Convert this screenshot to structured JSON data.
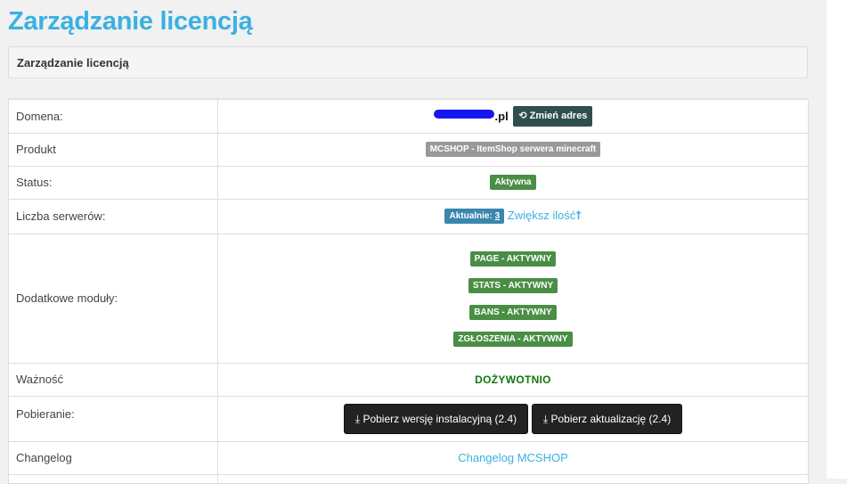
{
  "page": {
    "title": "Zarządzanie licencją",
    "panel_heading": "Zarządzanie licencją"
  },
  "rows": {
    "domain": {
      "label": "Domena:",
      "value_suffix": ".pl",
      "change_button": "Zmień adres"
    },
    "product": {
      "label": "Produkt",
      "value": "MCSHOP - ItemShop serwera minecraft"
    },
    "status": {
      "label": "Status:",
      "value": "Aktywna"
    },
    "servers": {
      "label": "Liczba serwerów:",
      "current_label": "Aktualnie:",
      "current_value": "3",
      "increase_link": "Zwiększ ilość"
    },
    "modules": {
      "label": "Dodatkowe moduły:",
      "items": [
        "PAGE - AKTYWNY",
        "STATS - AKTYWNY",
        "BANS - AKTYWNY",
        "ZGŁOSZENIA - AKTYWNY"
      ]
    },
    "validity": {
      "label": "Ważność",
      "value": "DOŻYWOTNIO"
    },
    "download": {
      "label": "Pobieranie:",
      "install_button": "Pobierz wersję instalacyjną (2.4)",
      "update_button": "Pobierz aktualizację (2.4)"
    },
    "changelog": {
      "label": "Changelog",
      "link": "Changelog MCSHOP"
    }
  },
  "colors": {
    "title": "#3ab1e1",
    "badge_gray": "#999999",
    "badge_green": "#4a8e45",
    "badge_blue": "#3a87ad",
    "lifetime_green": "#117511",
    "redacted_blue": "#1515f2"
  }
}
